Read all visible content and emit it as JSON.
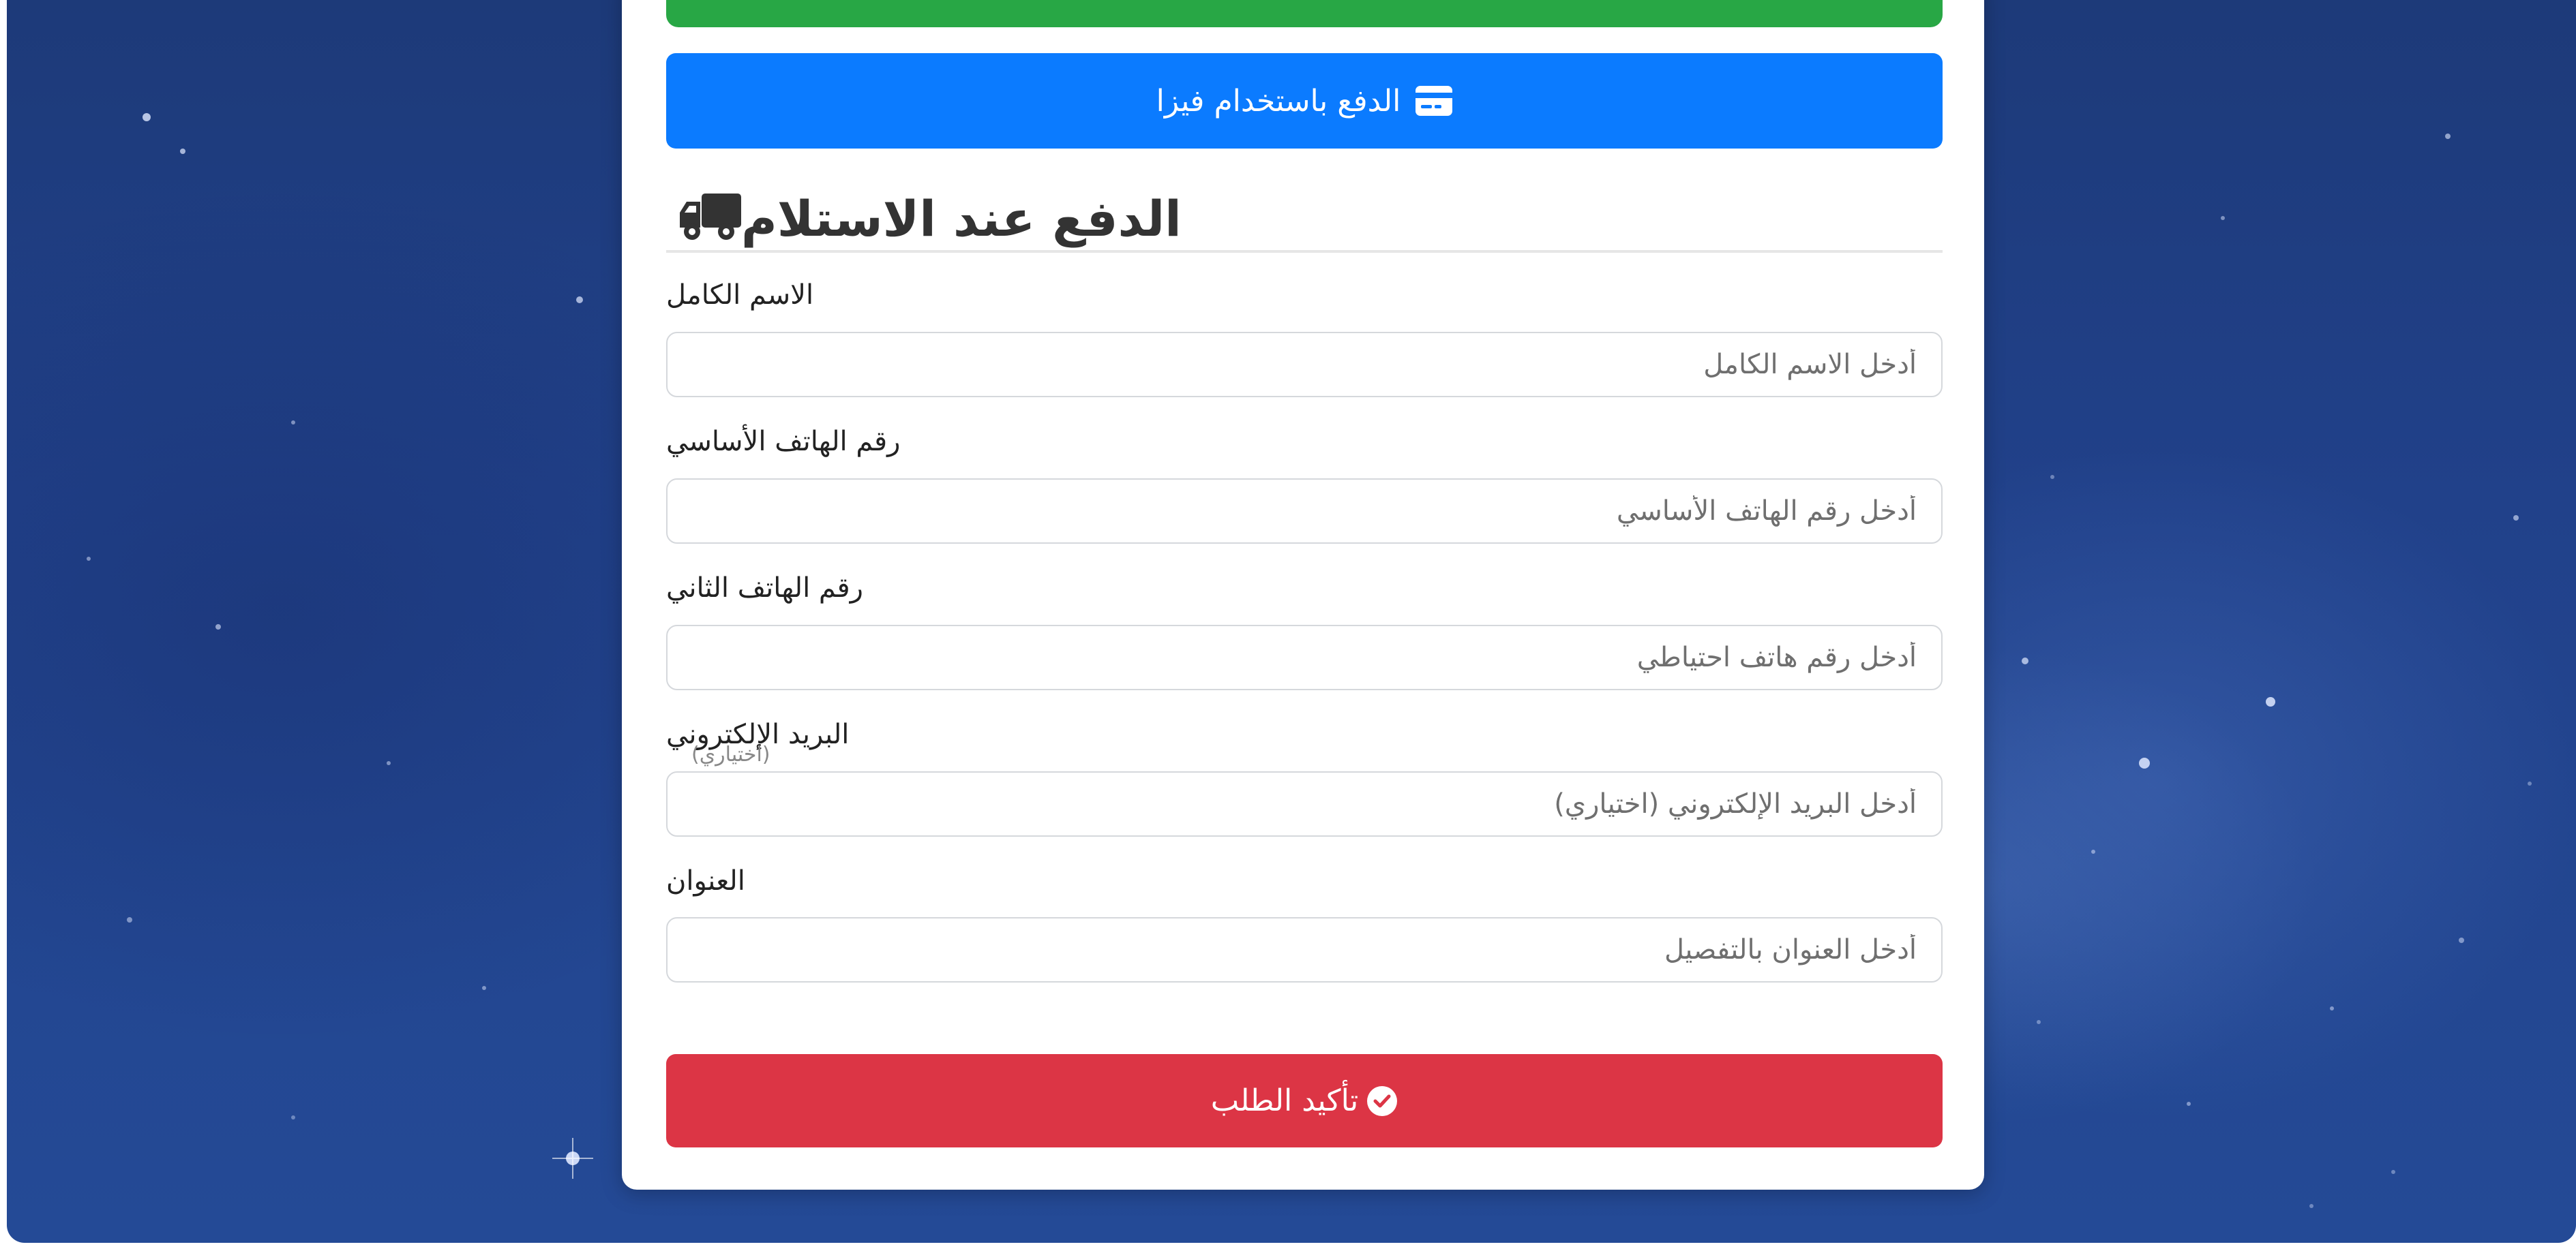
{
  "payment": {
    "visa_label": "الدفع باستخدام فيزا",
    "cod_title": "الدفع عند الاستلام"
  },
  "form": {
    "full_name": {
      "label": "الاسم الكامل",
      "placeholder": "أدخل الاسم الكامل"
    },
    "primary_phone": {
      "label": "رقم الهاتف الأساسي",
      "placeholder": "أدخل رقم الهاتف الأساسي"
    },
    "secondary_phone": {
      "label": "رقم الهاتف الثاني",
      "placeholder": "أدخل رقم هاتف احتياطي"
    },
    "email": {
      "label": "البريد الإلكتروني",
      "note": "(اختياري)",
      "placeholder": "أدخل البريد الإلكتروني (اختياري)"
    },
    "address": {
      "label": "العنوان",
      "placeholder": "أدخل العنوان بالتفصيل"
    },
    "submit_label": "تأكيد الطلب"
  },
  "icons": {
    "visa": "credit-card-icon",
    "cod": "truck-icon",
    "submit": "check-circle-icon"
  },
  "colors": {
    "green_button": "#28a745",
    "blue_button": "#0b7bff",
    "red_button": "#dc3545",
    "background": "#1f3f87"
  }
}
